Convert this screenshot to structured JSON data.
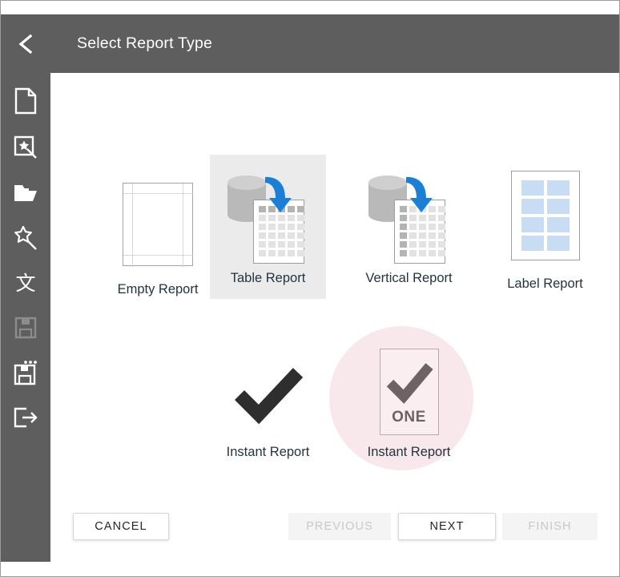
{
  "window": {
    "header_title": "Select Report Type",
    "back_icon": "chevron-left-icon",
    "header_bg": "#5e5e5e",
    "content_bg": "#ffffff"
  },
  "sidebar": {
    "bg": "#5e5e5e",
    "items": [
      {
        "name": "new-report",
        "icon": "page-icon",
        "enabled": true
      },
      {
        "name": "report-wizard",
        "icon": "page-magic-wand-icon",
        "enabled": true
      },
      {
        "name": "open-report",
        "icon": "open-folder-icon",
        "enabled": true
      },
      {
        "name": "magic-wand",
        "icon": "magic-wand-star-icon",
        "enabled": true
      },
      {
        "name": "text-language",
        "icon": "cjk-text-icon",
        "glyph": "文",
        "enabled": true
      },
      {
        "name": "save",
        "icon": "floppy-disk-icon",
        "enabled": false
      },
      {
        "name": "save-as",
        "icon": "floppy-disk-dots-icon",
        "enabled": true
      },
      {
        "name": "exit",
        "icon": "exit-arrow-icon",
        "enabled": true
      }
    ]
  },
  "report_types": [
    {
      "id": "empty-report",
      "label": "Empty Report",
      "art": "empty-page",
      "selected": false
    },
    {
      "id": "table-report",
      "label": "Table Report",
      "art": "db-to-table-doc",
      "selected": true,
      "selected_bg": "#ebebeb"
    },
    {
      "id": "vertical-report",
      "label": "Vertical Report",
      "art": "db-to-vertical-doc",
      "selected": false
    },
    {
      "id": "label-report",
      "label": "Label Report",
      "art": "label-page",
      "selected": false
    },
    {
      "id": "instant-report",
      "label": "Instant Report",
      "art": "checkmark",
      "selected": false
    },
    {
      "id": "instant-report-one",
      "label": "Instant Report",
      "art": "checkmark-one-boxed",
      "selected": false,
      "annotation": {
        "type": "highlight-circle",
        "color": "#f9e8eb",
        "badge_text": "ONE"
      }
    }
  ],
  "colors": {
    "accent_blue": "#1c7fd6",
    "cylinder_gray": "#b9b9b9",
    "cell_gray": "#e2e2e2",
    "cell_dark_gray": "#b4b4b4",
    "label_blue": "#c8ddf3",
    "label_text": "#25333f",
    "check_dark": "#2e2e2e",
    "check_muted": "#6f6166"
  },
  "footer": {
    "buttons": [
      {
        "id": "cancel",
        "label": "CANCEL",
        "enabled": true
      },
      {
        "id": "previous",
        "label": "PREVIOUS",
        "enabled": false
      },
      {
        "id": "next",
        "label": "NEXT",
        "enabled": true
      },
      {
        "id": "finish",
        "label": "FINISH",
        "enabled": false
      }
    ]
  }
}
